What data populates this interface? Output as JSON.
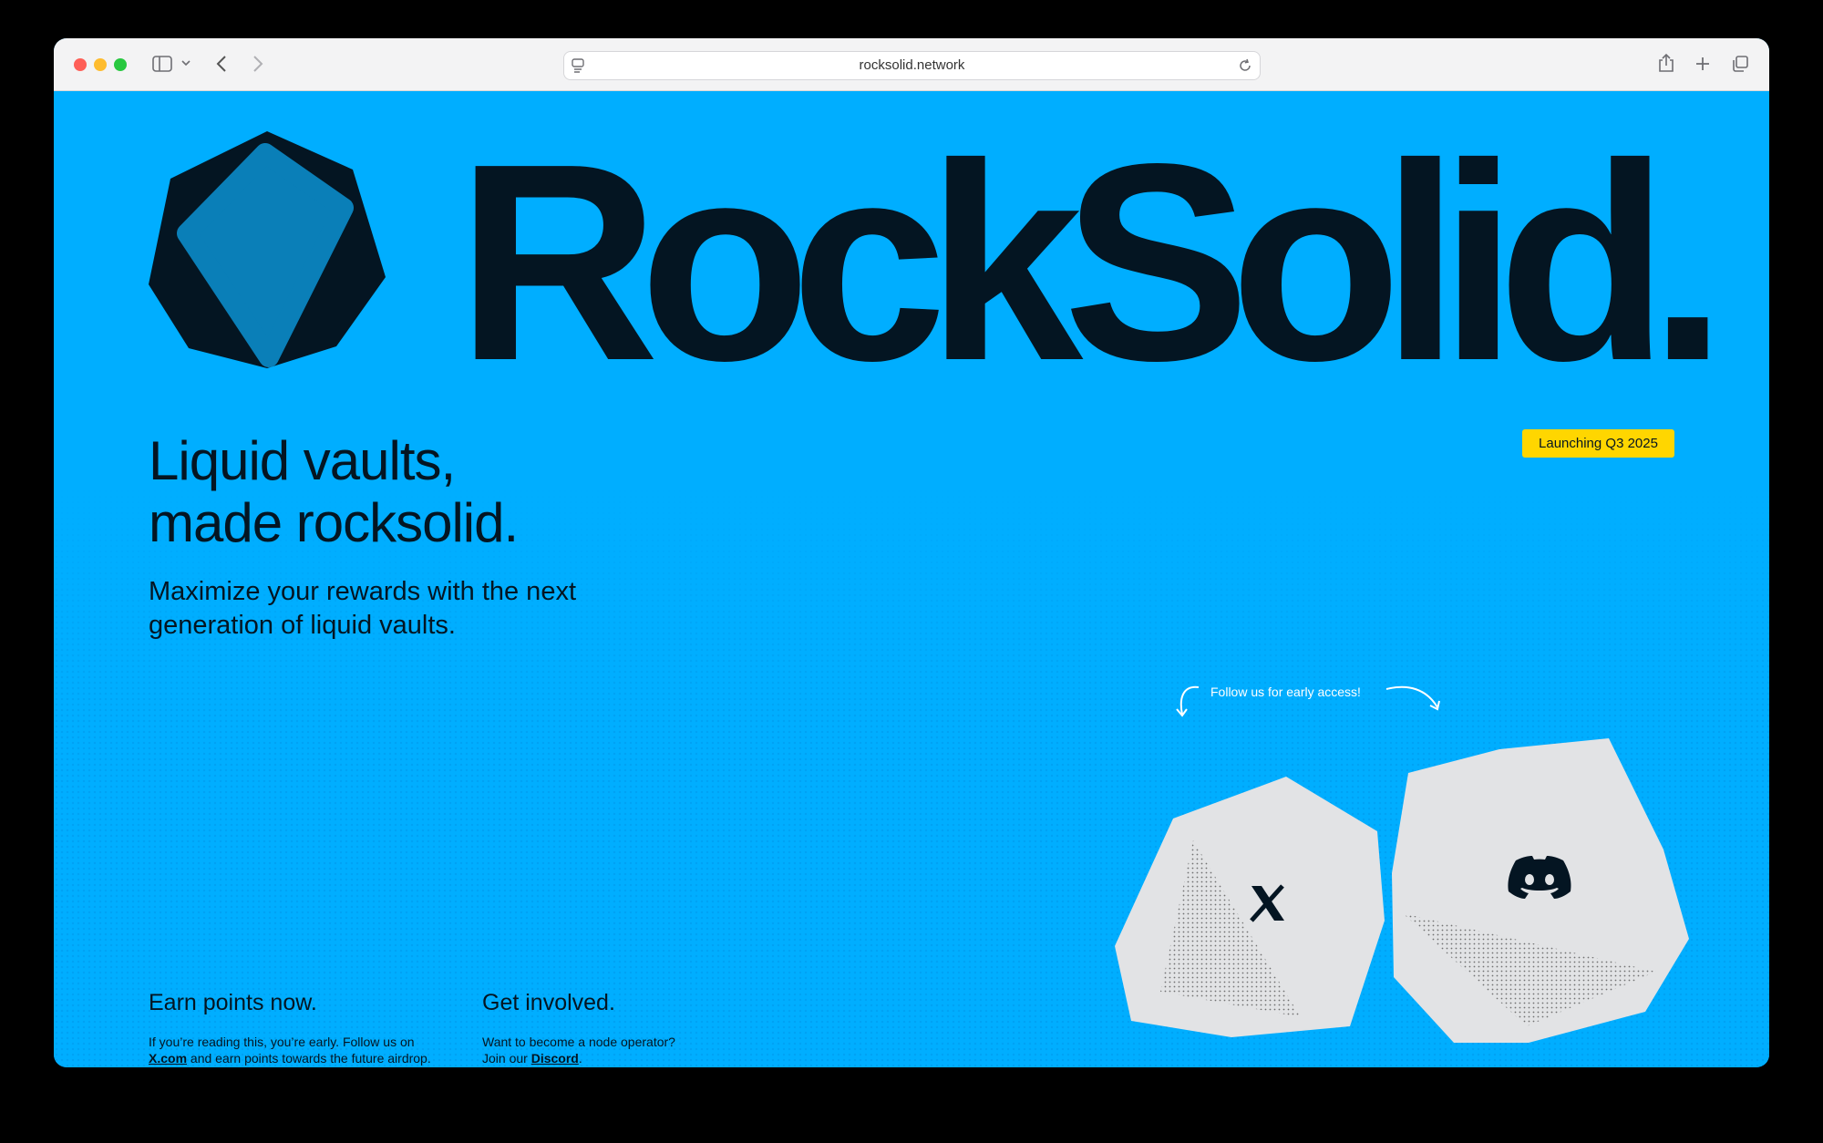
{
  "browser": {
    "url": "rocksolid.network"
  },
  "brand": {
    "wordmark": "RockSolid."
  },
  "badge": {
    "label": "Launching Q3 2025",
    "color": "#ffd600"
  },
  "hero": {
    "headline_line1": "Liquid vaults,",
    "headline_line2": "made rocksolid.",
    "subhead": "Maximize your rewards with the next generation of liquid vaults."
  },
  "social": {
    "prompt": "Follow us for early access!",
    "x_icon": "x-logo-icon",
    "discord_icon": "discord-logo-icon"
  },
  "columns": [
    {
      "title": "Earn points now.",
      "text_before": "If you’re reading this, you’re early. Follow us on",
      "link": "X.com",
      "text_after": " and earn points towards the future airdrop."
    },
    {
      "title": "Get involved.",
      "text_before": "Want to become a node operator?",
      "text_mid": "Join our ",
      "link": "Discord",
      "text_after": "."
    }
  ],
  "colors": {
    "background": "#00aeff",
    "ink": "#041522",
    "logo_inner": "#0a7fb8",
    "rock": "#e2e3e5"
  }
}
